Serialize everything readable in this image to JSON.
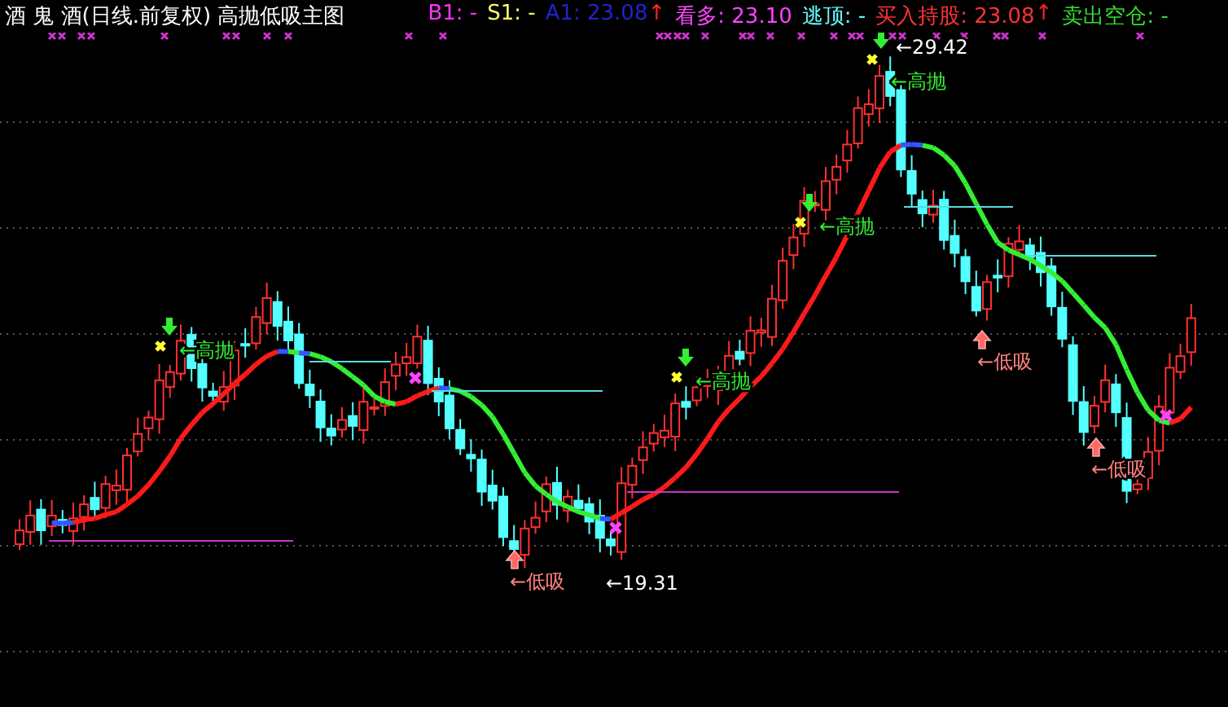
{
  "title": "酒 鬼 酒(日线.前复权) 高抛低吸主图",
  "indicators": [
    {
      "kind": "value",
      "text": "B1: -",
      "color": "#ff33ff"
    },
    {
      "kind": "value",
      "text": "S1: -",
      "color": "#ffff66"
    },
    {
      "kind": "value",
      "text": "A1: 23.08",
      "color": "#2222cc"
    },
    {
      "kind": "arrow",
      "text": "↑",
      "color": "#ff2222"
    },
    {
      "kind": "value",
      "text": "看多: 23.10",
      "color": "#ff44ff"
    },
    {
      "kind": "value",
      "text": "逃顶: -",
      "color": "#66ffff"
    },
    {
      "kind": "value",
      "text": "买入持股: 23.08",
      "color": "#ff3333"
    },
    {
      "kind": "arrow",
      "text": "↑",
      "color": "#ff2222"
    },
    {
      "kind": "value",
      "text": "卖出空仓: -",
      "color": "#33dd33"
    }
  ],
  "chart": {
    "max_label": "←29.42",
    "min_label": "←19.31",
    "signals": [
      {
        "kind": "sell",
        "text": "←高抛"
      },
      {
        "kind": "sell",
        "text": "←高抛"
      },
      {
        "kind": "sell",
        "text": "←高抛"
      },
      {
        "kind": "sell",
        "text": "←高抛"
      },
      {
        "kind": "buy",
        "text": "←低吸"
      },
      {
        "kind": "buy",
        "text": "←低吸"
      },
      {
        "kind": "buy",
        "text": "←低吸"
      }
    ]
  }
}
